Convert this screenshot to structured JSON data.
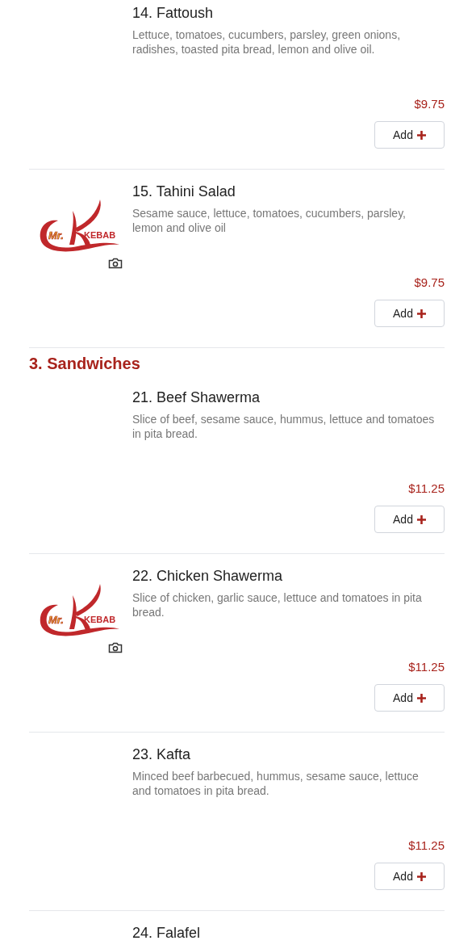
{
  "menu": [
    {
      "kind": "dish",
      "name": "14. Fattoush",
      "description": "Lettuce, tomatoes, cucumbers, parsley, green onions, radishes, toasted pita bread, lemon and olive oil.",
      "price": "$9.75",
      "button": "Add"
    },
    {
      "kind": "dish",
      "name": "15. Tahini Salad",
      "description": "Sesame sauce, lettuce, tomatoes, cucumbers, parsley, lemon and olive oil",
      "price": "$9.75",
      "button": "Add",
      "logo": {
        "prefix": "Mr.",
        "name": "KEBAB"
      }
    },
    {
      "kind": "section",
      "title": "3. Sandwiches"
    },
    {
      "kind": "dish",
      "name": "21. Beef Shawerma",
      "description": "Slice of beef, sesame sauce, hummus, lettuce and tomatoes in pita bread.",
      "price": "$11.25",
      "button": "Add"
    },
    {
      "kind": "dish",
      "name": "22. Chicken Shawerma",
      "description": "Slice of chicken, garlic sauce, lettuce and tomatoes in pita bread.",
      "price": "$11.25",
      "button": "Add",
      "logo": {
        "prefix": "Mr.",
        "name": "KEBAB"
      }
    },
    {
      "kind": "dish",
      "name": "23. Kafta",
      "description": "Minced beef barbecued, hummus, sesame sauce, lettuce and tomatoes in pita bread.",
      "price": "$11.25",
      "button": "Add"
    },
    {
      "kind": "dish",
      "name": "24. Falafel"
    }
  ]
}
